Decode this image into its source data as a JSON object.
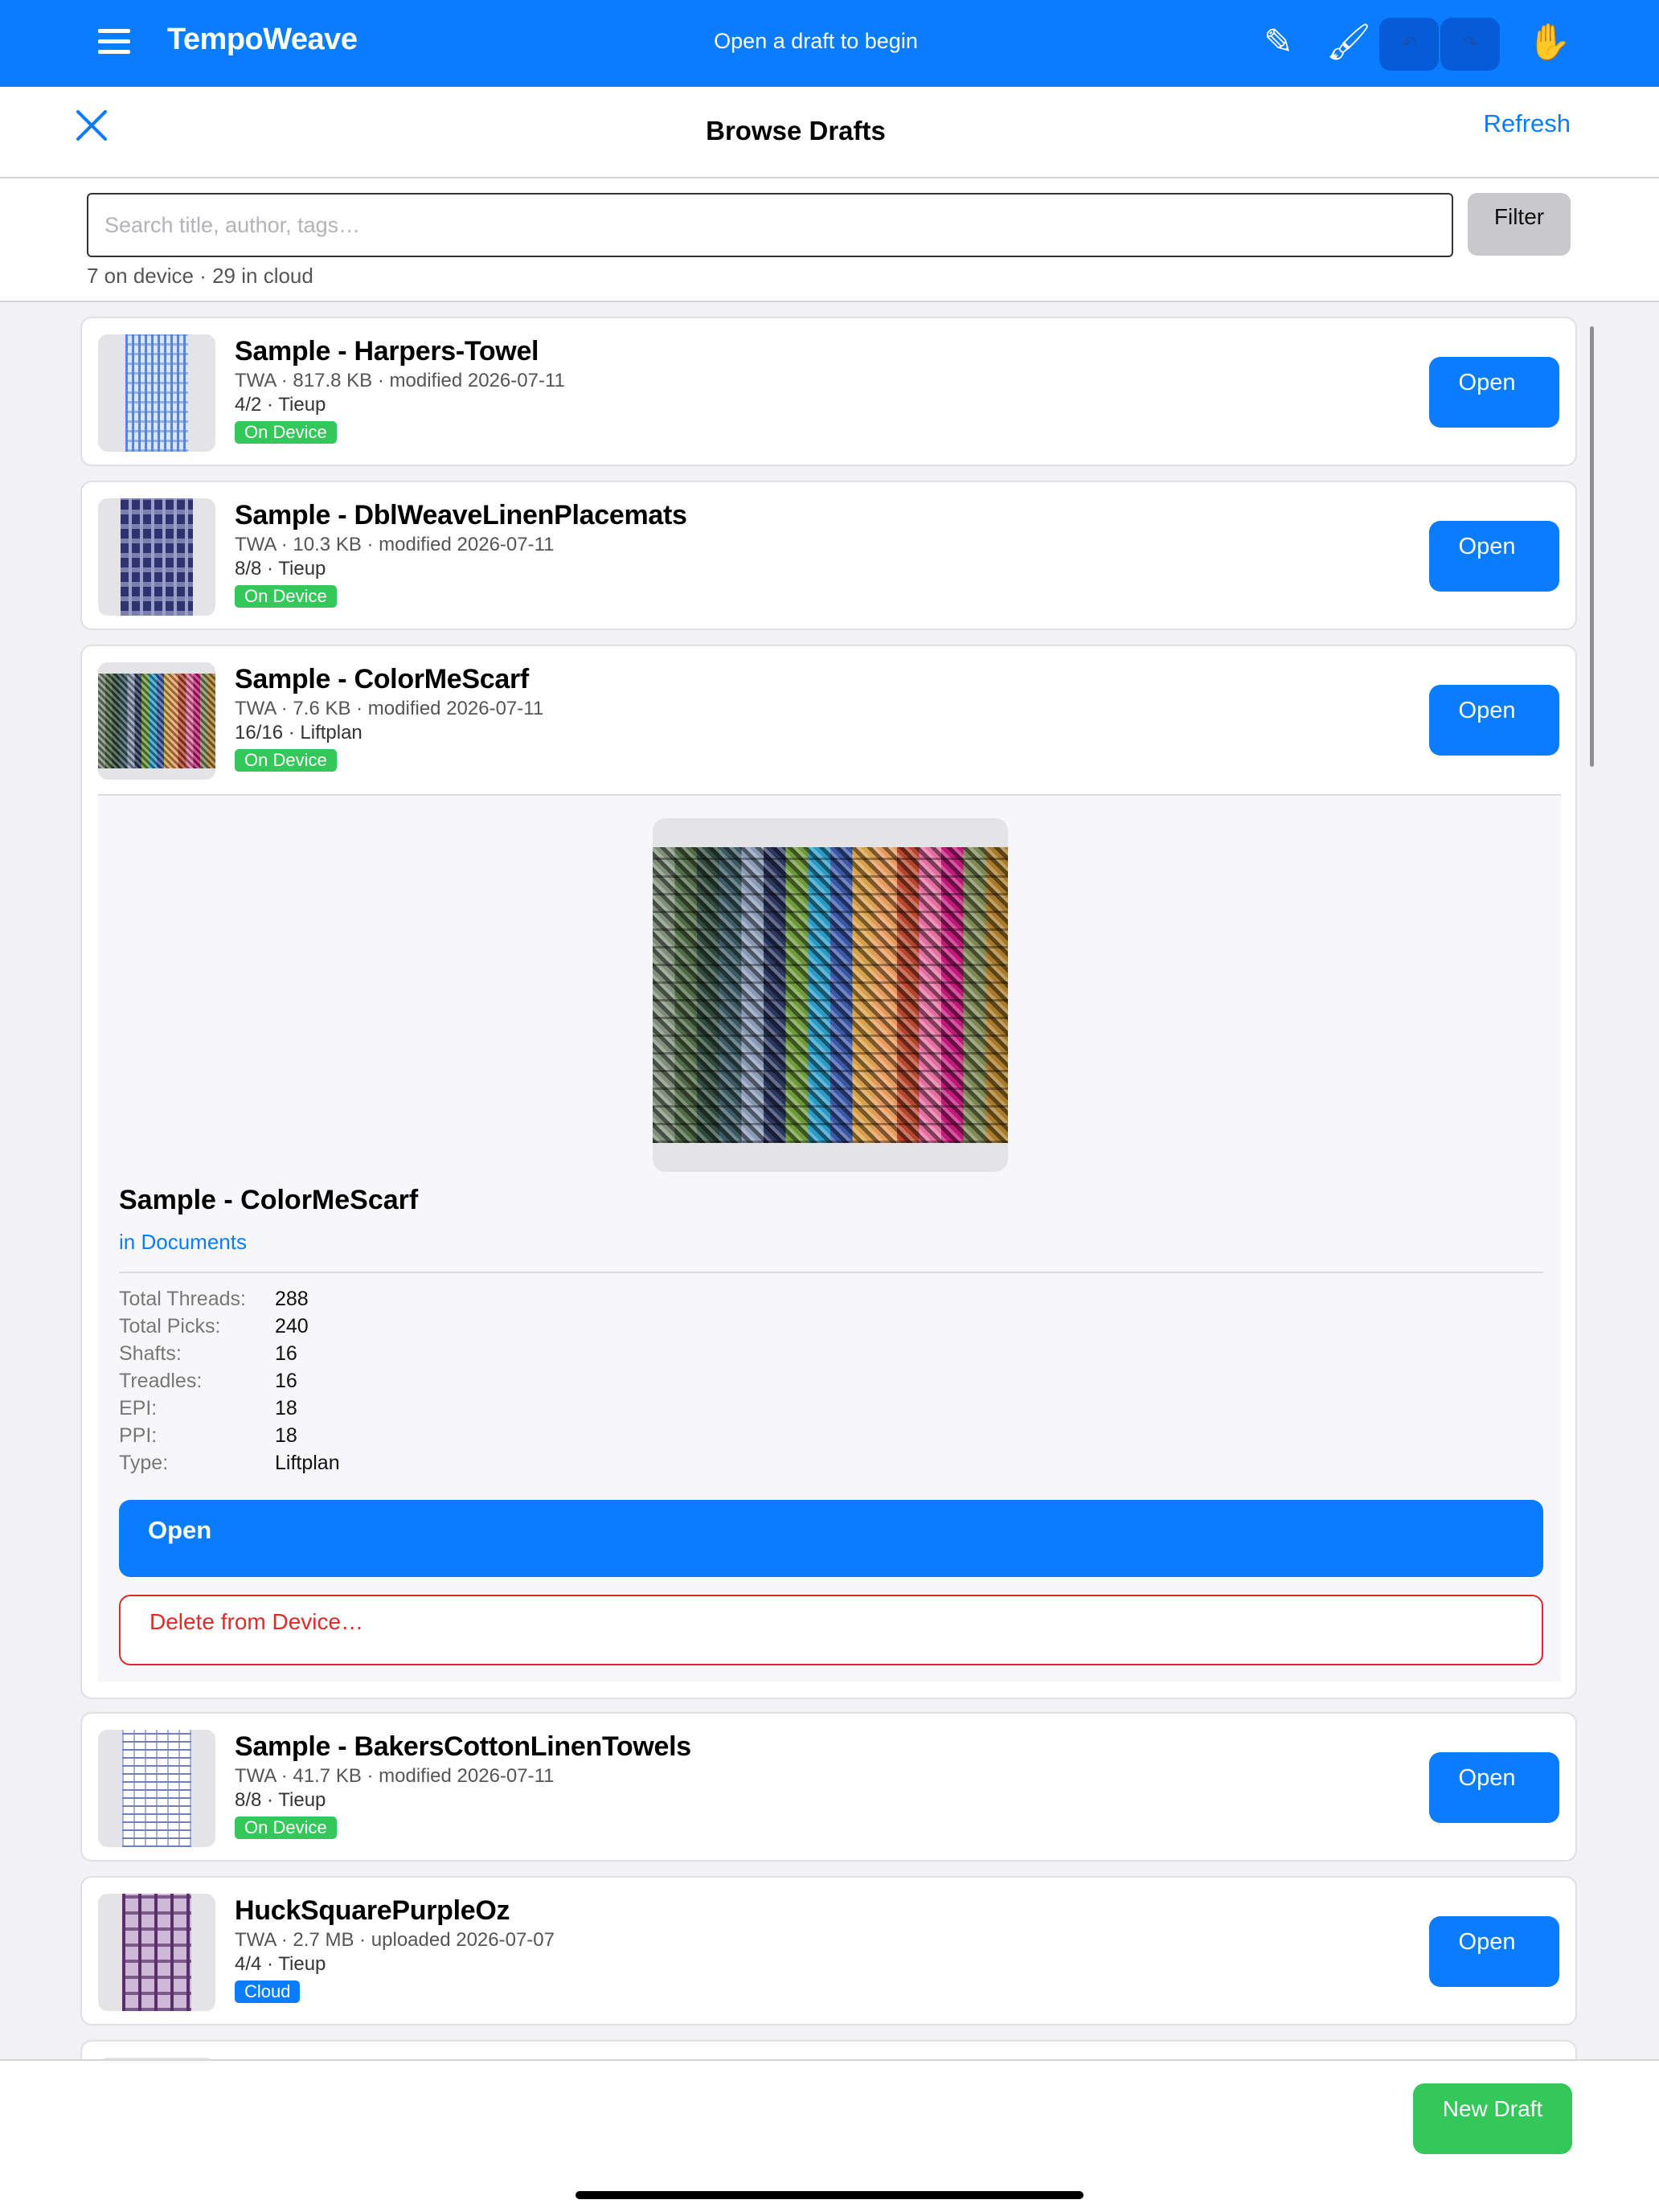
{
  "app": {
    "title": "TempoWeave",
    "status": "Open a draft to begin",
    "undo_glyph": "↶",
    "redo_glyph": "↷"
  },
  "modal": {
    "title": "Browse Drafts",
    "refresh_label": "Refresh"
  },
  "search": {
    "placeholder": "Search title, author, tags…",
    "value": "",
    "filter_label": "Filter",
    "counts": "7 on device · 29 in cloud"
  },
  "drafts": [
    {
      "title": "Sample - Harpers-Towel",
      "meta": "TWA · 817.8 KB · modified 2026-07-11",
      "sub": "4/2 · Tieup",
      "badge": "On Device",
      "open_label": "Open",
      "thumb_colors": [
        "#d7e6f7",
        "#5b84d6"
      ]
    },
    {
      "title": "Sample - DblWeaveLinenPlacemats",
      "meta": "TWA · 10.3 KB · modified 2026-07-11",
      "sub": "8/8 · Tieup",
      "badge": "On Device",
      "open_label": "Open",
      "thumb_colors": [
        "#2d3270",
        "#9aa0c8"
      ]
    },
    {
      "title": "Sample - ColorMeScarf",
      "meta": "TWA · 7.6 KB · modified 2026-07-11",
      "sub": "16/16 · Liftplan",
      "badge": "On Device",
      "open_label": "Open",
      "thumb_colors": [
        "#2d4a3a",
        "#d08a2a",
        "#c0267a"
      ]
    },
    {
      "title": "Sample - BakersCottonLinenTowels",
      "meta": "TWA · 41.7 KB · modified 2026-07-11",
      "sub": "8/8 · Tieup",
      "badge": "On Device",
      "open_label": "Open",
      "thumb_colors": [
        "#ffffff",
        "#6f7fb8"
      ]
    },
    {
      "title": "HuckSquarePurpleOz",
      "meta": "TWA · 2.7 MB · uploaded 2026-07-07",
      "sub": "4/4 · Tieup",
      "badge": "Cloud",
      "open_label": "Open",
      "thumb_colors": [
        "#5a2f6a",
        "#cdbad8"
      ]
    }
  ],
  "detail": {
    "title": "Sample - ColorMeScarf",
    "location": "in Documents",
    "stats": [
      {
        "label": "Total Threads:",
        "value": "288"
      },
      {
        "label": "Total Picks:",
        "value": "240"
      },
      {
        "label": "Shafts:",
        "value": "16"
      },
      {
        "label": "Treadles:",
        "value": "16"
      },
      {
        "label": "EPI:",
        "value": "18"
      },
      {
        "label": "PPI:",
        "value": "18"
      },
      {
        "label": "Type:",
        "value": "Liftplan"
      }
    ],
    "open_label": "Open",
    "delete_label": "Delete from Device…",
    "stripe_colors": [
      "#7f8f7a",
      "#4f6a45",
      "#2f4a3c",
      "#3b5a63",
      "#8a9ab6",
      "#2c3760",
      "#6f9a3a",
      "#2a9bc7",
      "#3a58a8",
      "#d9a04a",
      "#e89a5a",
      "#b7452b",
      "#e56da0",
      "#c0197a",
      "#7d8a55",
      "#a87a2a"
    ]
  },
  "footer": {
    "new_draft_label": "New Draft"
  }
}
